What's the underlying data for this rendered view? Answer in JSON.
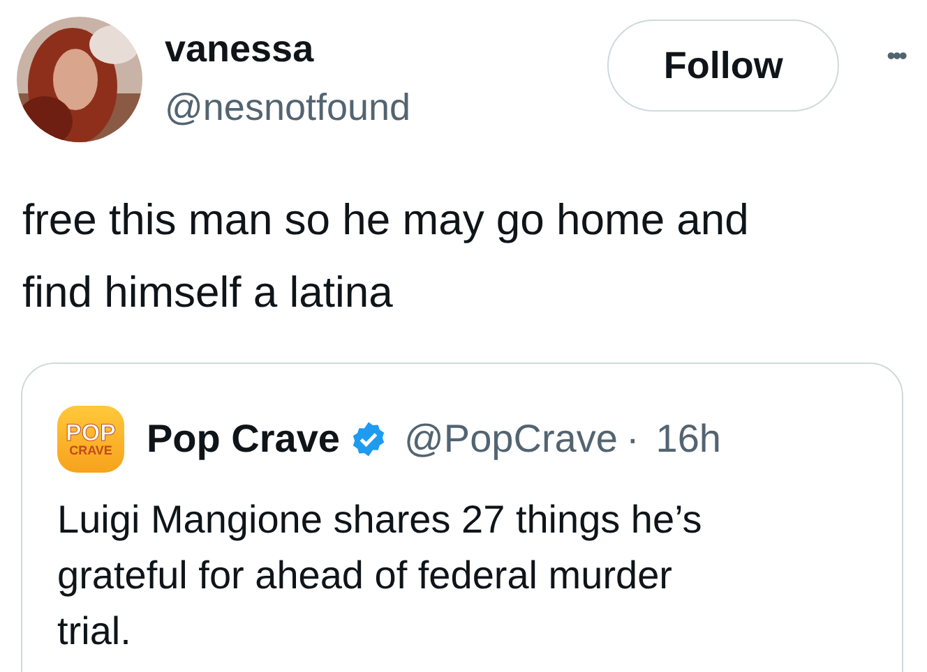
{
  "author": {
    "name": "vanessa",
    "handle": "@nesnotfound"
  },
  "follow_button": "Follow",
  "more_button": "•••",
  "text": "free this man so he may go home and find himself a latina",
  "quote": {
    "logo": {
      "top": "POP",
      "bottom": "CRAVE"
    },
    "name": "Pop Crave",
    "verified": true,
    "handle": "@PopCrave",
    "separator": "·",
    "time": "16h",
    "text": "Luigi Mangione shares 27 things he’s grateful for ahead of federal murder trial."
  }
}
